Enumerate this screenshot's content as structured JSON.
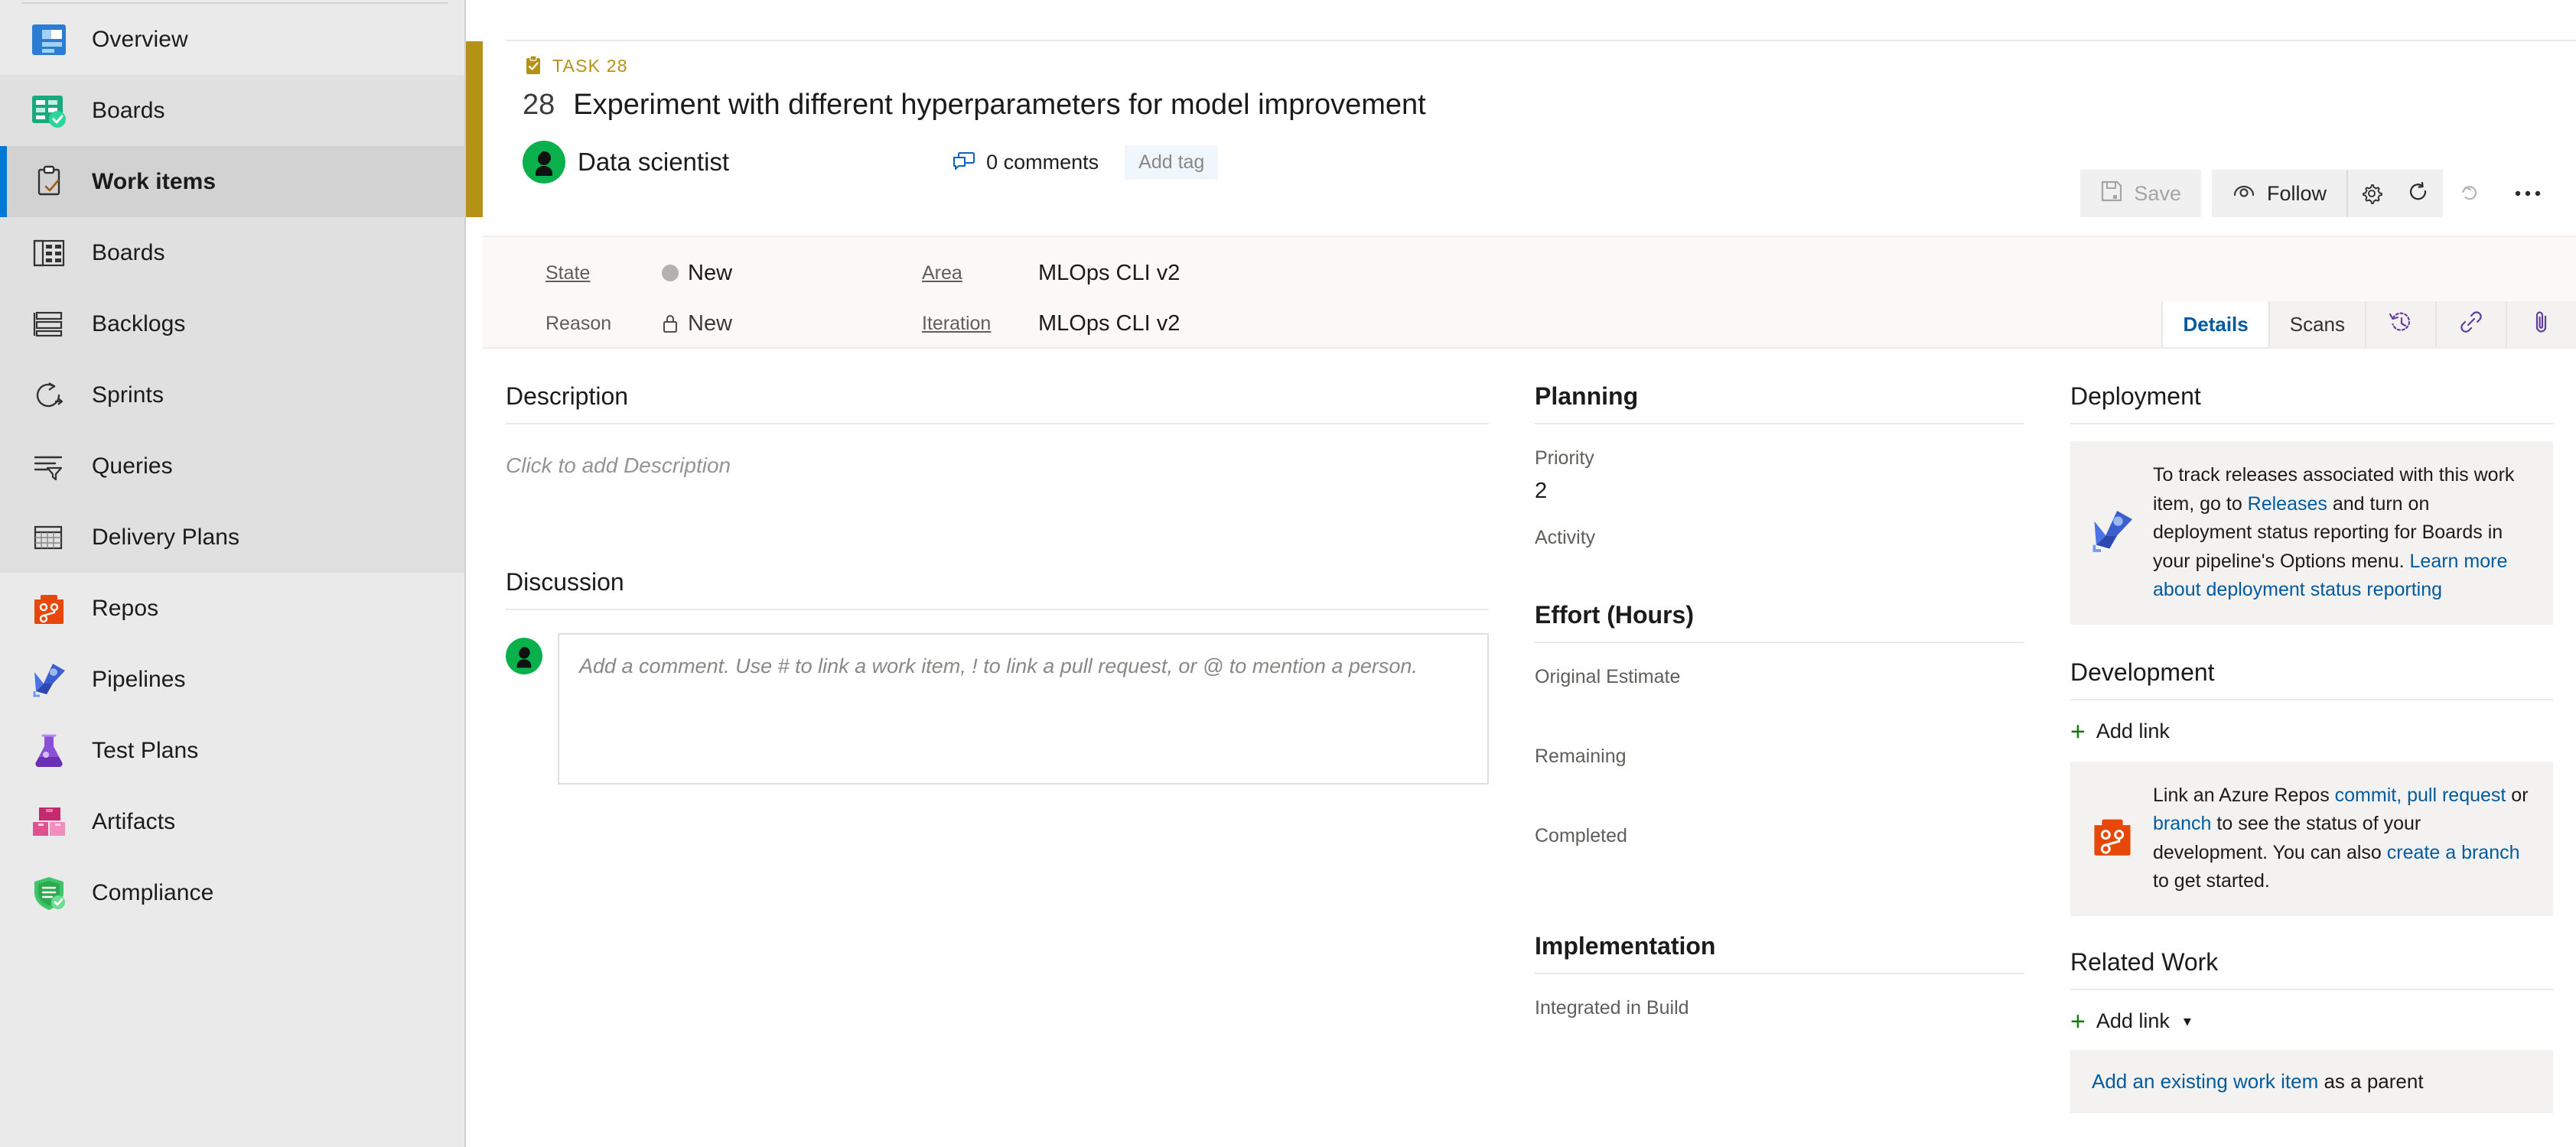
{
  "sidebar": {
    "groups": [
      {
        "items": [
          {
            "label": "Overview",
            "icon": "overview-icon",
            "active": false
          }
        ]
      },
      {
        "items": [
          {
            "label": "Boards",
            "icon": "boards-icon",
            "active": false
          },
          {
            "label": "Work items",
            "icon": "work-items-icon",
            "active": true
          },
          {
            "label": "Boards",
            "icon": "board-grid-icon",
            "active": false
          },
          {
            "label": "Backlogs",
            "icon": "backlogs-icon",
            "active": false
          },
          {
            "label": "Sprints",
            "icon": "sprints-icon",
            "active": false
          },
          {
            "label": "Queries",
            "icon": "queries-icon",
            "active": false
          },
          {
            "label": "Delivery Plans",
            "icon": "delivery-plans-icon",
            "active": false
          }
        ]
      },
      {
        "items": [
          {
            "label": "Repos",
            "icon": "repos-icon",
            "active": false
          },
          {
            "label": "Pipelines",
            "icon": "pipelines-icon",
            "active": false
          },
          {
            "label": "Test Plans",
            "icon": "test-plans-icon",
            "active": false
          },
          {
            "label": "Artifacts",
            "icon": "artifacts-icon",
            "active": false
          },
          {
            "label": "Compliance",
            "icon": "compliance-icon",
            "active": false
          }
        ]
      }
    ]
  },
  "work_item": {
    "type_label": "TASK 28",
    "id": "28",
    "title": "Experiment with different hyperparameters for model improvement",
    "assigned_to": "Data scientist",
    "comments_count": "0 comments",
    "add_tag": "Add tag",
    "accent_color": "#b49216"
  },
  "toolbar": {
    "save_label": "Save",
    "follow_label": "Follow"
  },
  "fields": {
    "state_label": "State",
    "state_value": "New",
    "reason_label": "Reason",
    "reason_value": "New",
    "area_label": "Area",
    "area_value": "MLOps CLI v2",
    "iteration_label": "Iteration",
    "iteration_value": "MLOps CLI v2"
  },
  "tabs": [
    {
      "label": "Details",
      "active": true
    },
    {
      "label": "Scans",
      "active": false
    },
    {
      "label": "",
      "icon": "history-icon",
      "active": false
    },
    {
      "label": "",
      "icon": "link-icon",
      "active": false
    },
    {
      "label": "",
      "icon": "attachment-icon",
      "active": false
    }
  ],
  "description": {
    "title": "Description",
    "placeholder": "Click to add Description"
  },
  "discussion": {
    "title": "Discussion",
    "placeholder": "Add a comment. Use # to link a work item, ! to link a pull request, or @ to mention a person."
  },
  "planning": {
    "title": "Planning",
    "priority_label": "Priority",
    "priority_value": "2",
    "activity_label": "Activity",
    "activity_value": ""
  },
  "effort": {
    "title": "Effort (Hours)",
    "original_estimate_label": "Original Estimate",
    "remaining_label": "Remaining",
    "completed_label": "Completed"
  },
  "implementation": {
    "title": "Implementation",
    "integrated_in_build_label": "Integrated in Build"
  },
  "deployment": {
    "title": "Deployment",
    "text_1": "To track releases associated with this work item, go to ",
    "link_1": "Releases",
    "text_2": " and turn on deployment status reporting for Boards in your pipeline's Options menu. ",
    "link_2": "Learn more about deployment status reporting"
  },
  "development": {
    "title": "Development",
    "add_link_label": "Add link",
    "text_1": "Link an Azure Repos ",
    "link_commit": "commit,",
    "link_pull_request": "pull request",
    "text_or": " or ",
    "link_branch": "branch",
    "text_2": " to see the status of your development. You can also ",
    "link_create_branch": "create a branch",
    "text_3": " to get started."
  },
  "related_work": {
    "title": "Related Work",
    "add_link_label": "Add link",
    "link_add_existing": "Add an existing work item",
    "text_as_parent": " as a parent"
  }
}
